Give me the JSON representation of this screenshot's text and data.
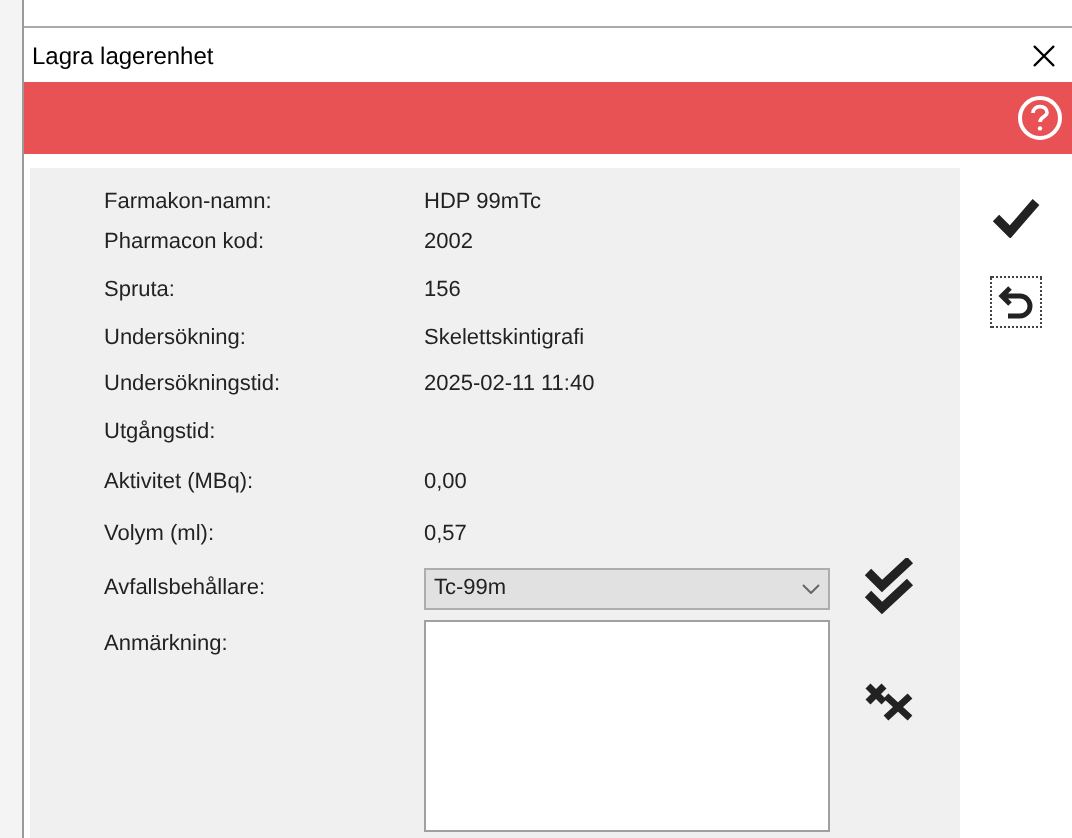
{
  "window": {
    "title": "Lagra lagerenhet"
  },
  "fields": [
    {
      "label": "Farmakon-namn:",
      "value": "HDP 99mTc"
    },
    {
      "label": "Pharmacon kod:",
      "value": "2002"
    },
    {
      "label": "Spruta:",
      "value": "156"
    },
    {
      "label": "Undersökning:",
      "value": "Skelettskintigrafi"
    },
    {
      "label": "Undersökningstid:",
      "value": "2025-02-11 11:40"
    },
    {
      "label": "Utgångstid:"
    },
    {
      "label": "Aktivitet (MBq):",
      "value": "0,00"
    },
    {
      "label": "Volym (ml):",
      "value": "0,57"
    }
  ],
  "waste_container": {
    "label": "Avfallsbehållare:",
    "value": "Tc-99m"
  },
  "remark": {
    "label": "Anmärkning:"
  }
}
